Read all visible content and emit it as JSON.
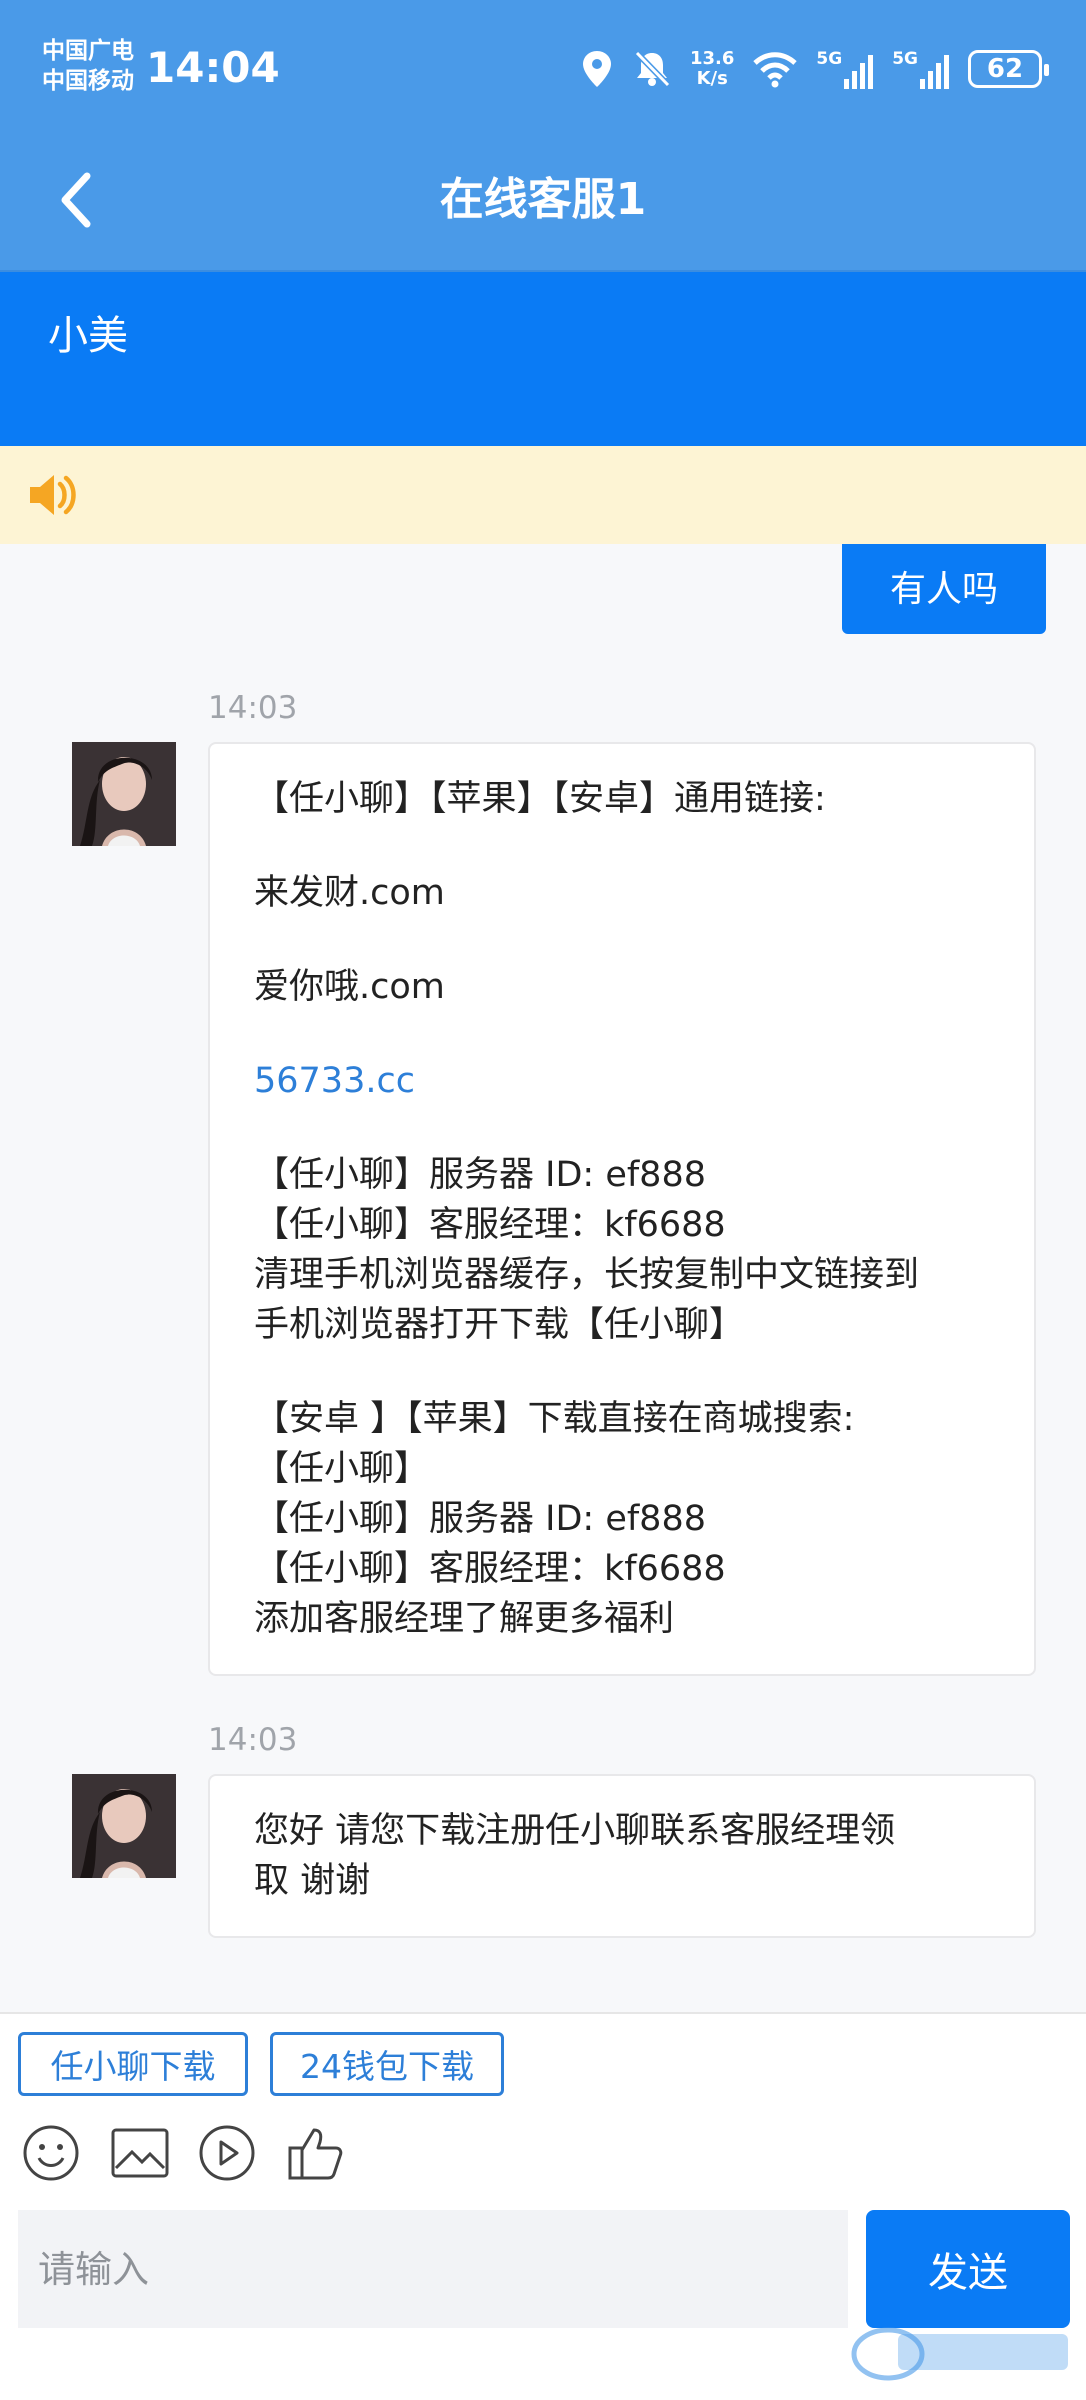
{
  "status_bar": {
    "carrier_1": "中国广电",
    "carrier_2": "中国移动",
    "time": "14:04",
    "net_speed_value": "13.6",
    "net_speed_unit": "K/s",
    "signal_1": "5G",
    "signal_2": "5G",
    "battery": "62"
  },
  "nav": {
    "title": "在线客服1",
    "back_icon": "chevron-left-icon"
  },
  "agent": {
    "name": "小美"
  },
  "notice": {
    "icon": "speaker-icon",
    "text": ""
  },
  "messages": {
    "mine_1": "有人吗",
    "group_1": {
      "time": "14:03",
      "lines": [
        "【任小聊】【苹果】【安卓】通用链接:",
        "来发财.com",
        "爱你哦.com",
        "56733.cc",
        "【任小聊】服务器 ID: ef888",
        "【任小聊】客服经理：kf6688",
        "清理手机浏览器缓存，长按复制中文链接到",
        "手机浏览器打开下载【任小聊】",
        "【安卓 】【苹果】下载直接在商城搜索:",
        "【任小聊】",
        "【任小聊】服务器 ID: ef888",
        "【任小聊】客服经理：kf6688",
        "添加客服经理了解更多福利"
      ]
    },
    "group_2": {
      "time": "14:03",
      "lines": [
        "您好 请您下载注册任小聊联系客服经理领",
        "取 谢谢"
      ]
    }
  },
  "quick_replies": [
    "任小聊下载",
    "24钱包下载"
  ],
  "toolbar": {
    "icons": [
      "emoji-icon",
      "image-icon",
      "video-icon",
      "thumbs-up-icon"
    ]
  },
  "composer": {
    "placeholder": "请输入",
    "value": "",
    "send_label": "发送"
  },
  "colors": {
    "header": "#4a9ae8",
    "primary": "#0a7bf5",
    "notice_bg": "#fdf4d4",
    "link": "#2d7fd8"
  }
}
